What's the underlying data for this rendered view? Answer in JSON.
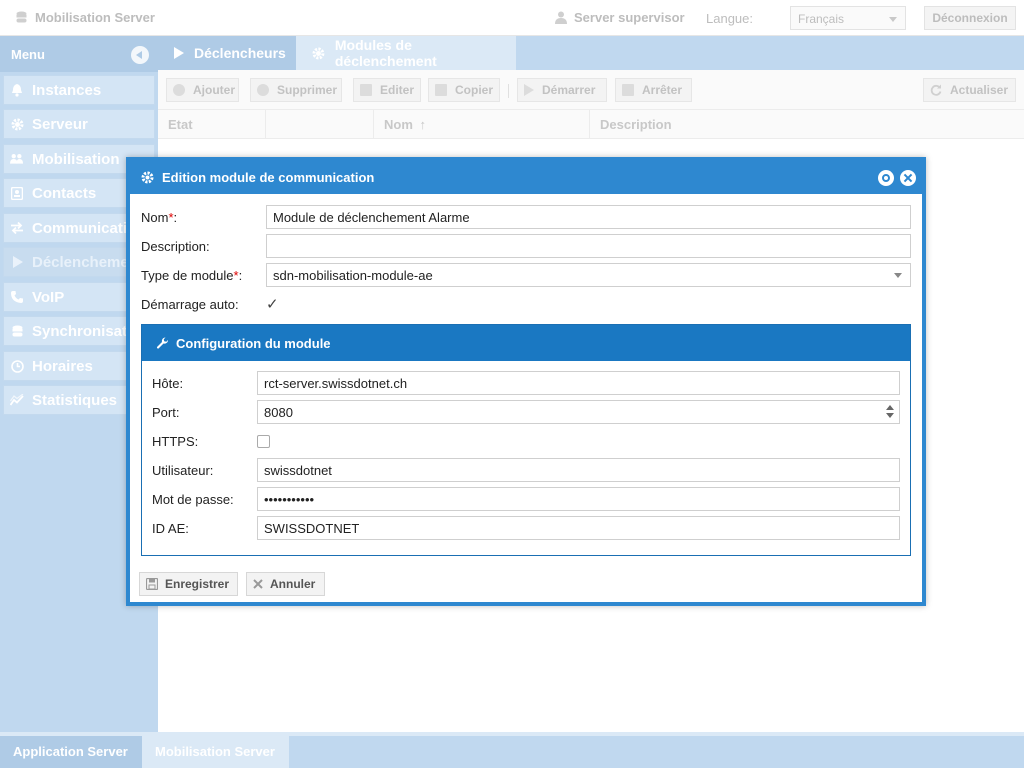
{
  "topbar": {
    "app_title": "Mobilisation Server",
    "user": "Server supervisor",
    "language_label": "Langue:",
    "language_value": "Français",
    "logout": "Déconnexion"
  },
  "menu": {
    "title": "Menu",
    "items": [
      {
        "label": "Instances",
        "icon": "bell-icon"
      },
      {
        "label": "Serveur",
        "icon": "gear-icon"
      },
      {
        "label": "Mobilisation",
        "icon": "users-icon"
      },
      {
        "label": "Contacts",
        "icon": "contact-card-icon"
      },
      {
        "label": "Communication",
        "icon": "exchange-icon"
      },
      {
        "label": "Déclenchement",
        "icon": "play-icon"
      },
      {
        "label": "VoIP",
        "icon": "phone-icon"
      },
      {
        "label": "Synchronisation",
        "icon": "database-icon"
      },
      {
        "label": "Horaires",
        "icon": "clock-icon"
      },
      {
        "label": "Statistiques",
        "icon": "chart-icon"
      }
    ]
  },
  "tabs": [
    {
      "label": "Déclencheurs",
      "icon": "play-icon"
    },
    {
      "label": "Modules de déclenchement",
      "icon": "gear-icon"
    }
  ],
  "toolbar": {
    "add": "Ajouter",
    "delete": "Supprimer",
    "edit": "Editer",
    "copy": "Copier",
    "start": "Démarrer",
    "stop": "Arrêter",
    "refresh": "Actualiser"
  },
  "grid": {
    "columns": [
      "Etat",
      "",
      "Nom",
      "Description"
    ]
  },
  "bottom_tabs": [
    "Application Server",
    "Mobilisation Server"
  ],
  "dialog": {
    "title": "Edition module de communication",
    "fields": {
      "name_label": "Nom",
      "name_value": "Module de déclenchement Alarme",
      "description_label": "Description:",
      "description_value": "",
      "module_type_label": "Type de module",
      "module_type_value": "sdn-mobilisation-module-ae",
      "autostart_label": "Démarrage auto:",
      "autostart_checked": true
    },
    "config": {
      "title": "Configuration du module",
      "host_label": "Hôte:",
      "host_value": "rct-server.swissdotnet.ch",
      "port_label": "Port:",
      "port_value": "8080",
      "https_label": "HTTPS:",
      "https_checked": false,
      "user_label": "Utilisateur:",
      "user_value": "swissdotnet",
      "password_label": "Mot de passe:",
      "password_value": "•••••••••••",
      "id_label": "ID AE:",
      "id_value": "SWISSDOTNET"
    },
    "buttons": {
      "save": "Enregistrer",
      "cancel": "Annuler"
    }
  }
}
